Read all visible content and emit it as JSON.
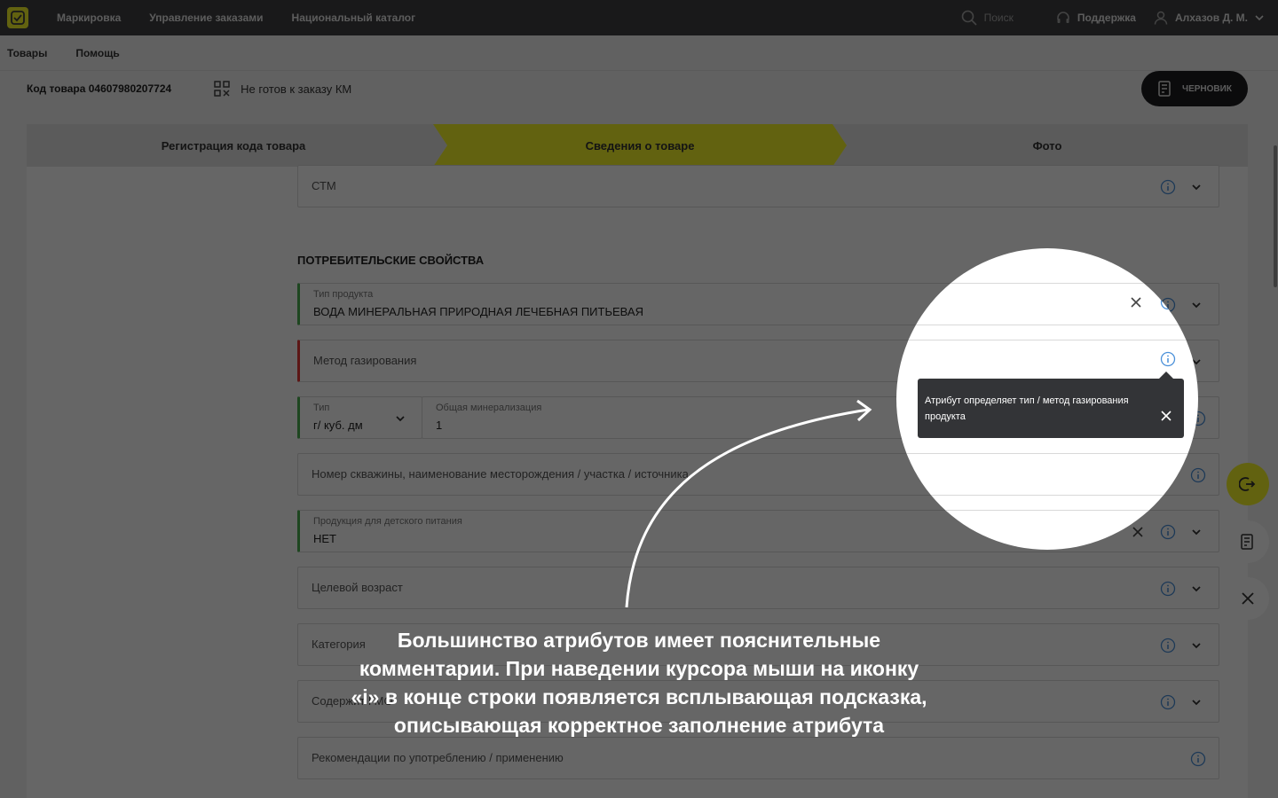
{
  "topbar": {
    "nav": [
      "Маркировка",
      "Управление заказами",
      "Национальный каталог"
    ],
    "search_label": "Поиск",
    "support_label": "Поддержка",
    "user_name": "Алхазов Д. М."
  },
  "subnav": {
    "items": [
      "Товары",
      "Помощь"
    ]
  },
  "product": {
    "code_label": "Код товара 04607980207724",
    "status_label": "Не готов к заказу КМ",
    "draft_button": "ЧЕРНОВИК"
  },
  "stepper": {
    "steps": [
      "Регистрация кода товара",
      "Сведения о товаре",
      "Фото"
    ],
    "active_index": 1,
    "active_color": "#f6f62a"
  },
  "form": {
    "stm_placeholder": "СТМ",
    "section_title": "ПОТРЕБИТЕЛЬСКИЕ СВОЙСТВА",
    "product_type": {
      "label": "Тип продукта",
      "value": "ВОДА МИНЕРАЛЬНАЯ ПРИРОДНАЯ ЛЕЧЕБНАЯ ПИТЬЕВАЯ"
    },
    "carbonation": {
      "placeholder": "Метод газирования"
    },
    "unit": {
      "label": "Тип",
      "value": "г/ куб. дм"
    },
    "mineralization": {
      "label": "Общая минерализация",
      "value": "1"
    },
    "well_number": {
      "placeholder": "Номер скважины, наименование месторождения / участка / источника"
    },
    "baby_food": {
      "label": "Продукция для детского питания",
      "value": "НЕТ"
    },
    "target_age": {
      "placeholder": "Целевой возраст"
    },
    "category": {
      "placeholder": "Категория"
    },
    "gmo": {
      "placeholder": "Содержит ГМО"
    },
    "recommendations": {
      "placeholder": "Рекомендации по употреблению / применению"
    }
  },
  "tooltip": {
    "text": "Атрибут определяет тип / метод газирования продукта"
  },
  "caption": {
    "text": "Большинство атрибутов имеет пояснительные комментарии. При наведении курсора мыши на иконку «i» в конце строки появляется всплывающая подсказка, описывающая корректное заполнение атрибута"
  },
  "colors": {
    "accent": "#f6f62a",
    "info_icon": "#4a90d9",
    "valid": "#4caf50",
    "invalid": "#e53935"
  }
}
